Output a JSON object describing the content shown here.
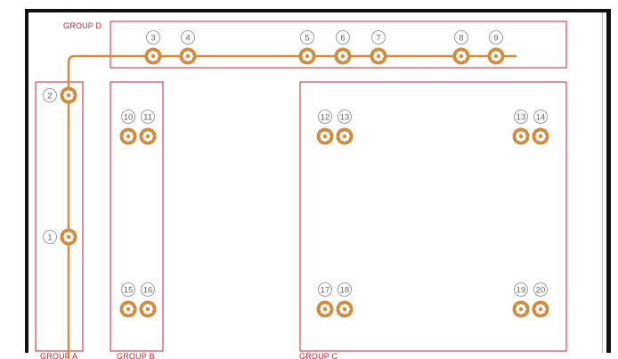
{
  "colors": {
    "group_border": "#cc2233",
    "wire": "#d08c3c",
    "led": "#d08c3c",
    "led_core": "#ffffff",
    "number_text": "#666666",
    "frame": "#111111"
  },
  "groups": [
    {
      "id": "A",
      "label": "GROUP A"
    },
    {
      "id": "B",
      "label": "GROUP B"
    },
    {
      "id": "C",
      "label": "GROUP C"
    },
    {
      "id": "D",
      "label": "GROUP D"
    }
  ],
  "leds": [
    {
      "number": "1",
      "group": "A",
      "connected": true
    },
    {
      "number": "2",
      "group": "A",
      "connected": true
    },
    {
      "number": "3",
      "group": "D",
      "connected": true
    },
    {
      "number": "4",
      "group": "D",
      "connected": true
    },
    {
      "number": "5",
      "group": "D",
      "connected": true
    },
    {
      "number": "6",
      "group": "D",
      "connected": true
    },
    {
      "number": "7",
      "group": "D",
      "connected": true
    },
    {
      "number": "8",
      "group": "D",
      "connected": true
    },
    {
      "number": "9",
      "group": "D",
      "connected": true
    },
    {
      "number": "10",
      "group": "B",
      "connected": false
    },
    {
      "number": "11",
      "group": "B",
      "connected": false
    },
    {
      "number": "15",
      "group": "B",
      "connected": false
    },
    {
      "number": "16",
      "group": "B",
      "connected": false
    },
    {
      "number": "12",
      "group": "C",
      "connected": false
    },
    {
      "number": "13",
      "group": "C",
      "connected": false
    },
    {
      "number": "13",
      "group": "C",
      "connected": false
    },
    {
      "number": "14",
      "group": "C",
      "connected": false
    },
    {
      "number": "17",
      "group": "C",
      "connected": false
    },
    {
      "number": "18",
      "group": "C",
      "connected": false
    },
    {
      "number": "19",
      "group": "C",
      "connected": false
    },
    {
      "number": "20",
      "group": "C",
      "connected": false
    }
  ]
}
